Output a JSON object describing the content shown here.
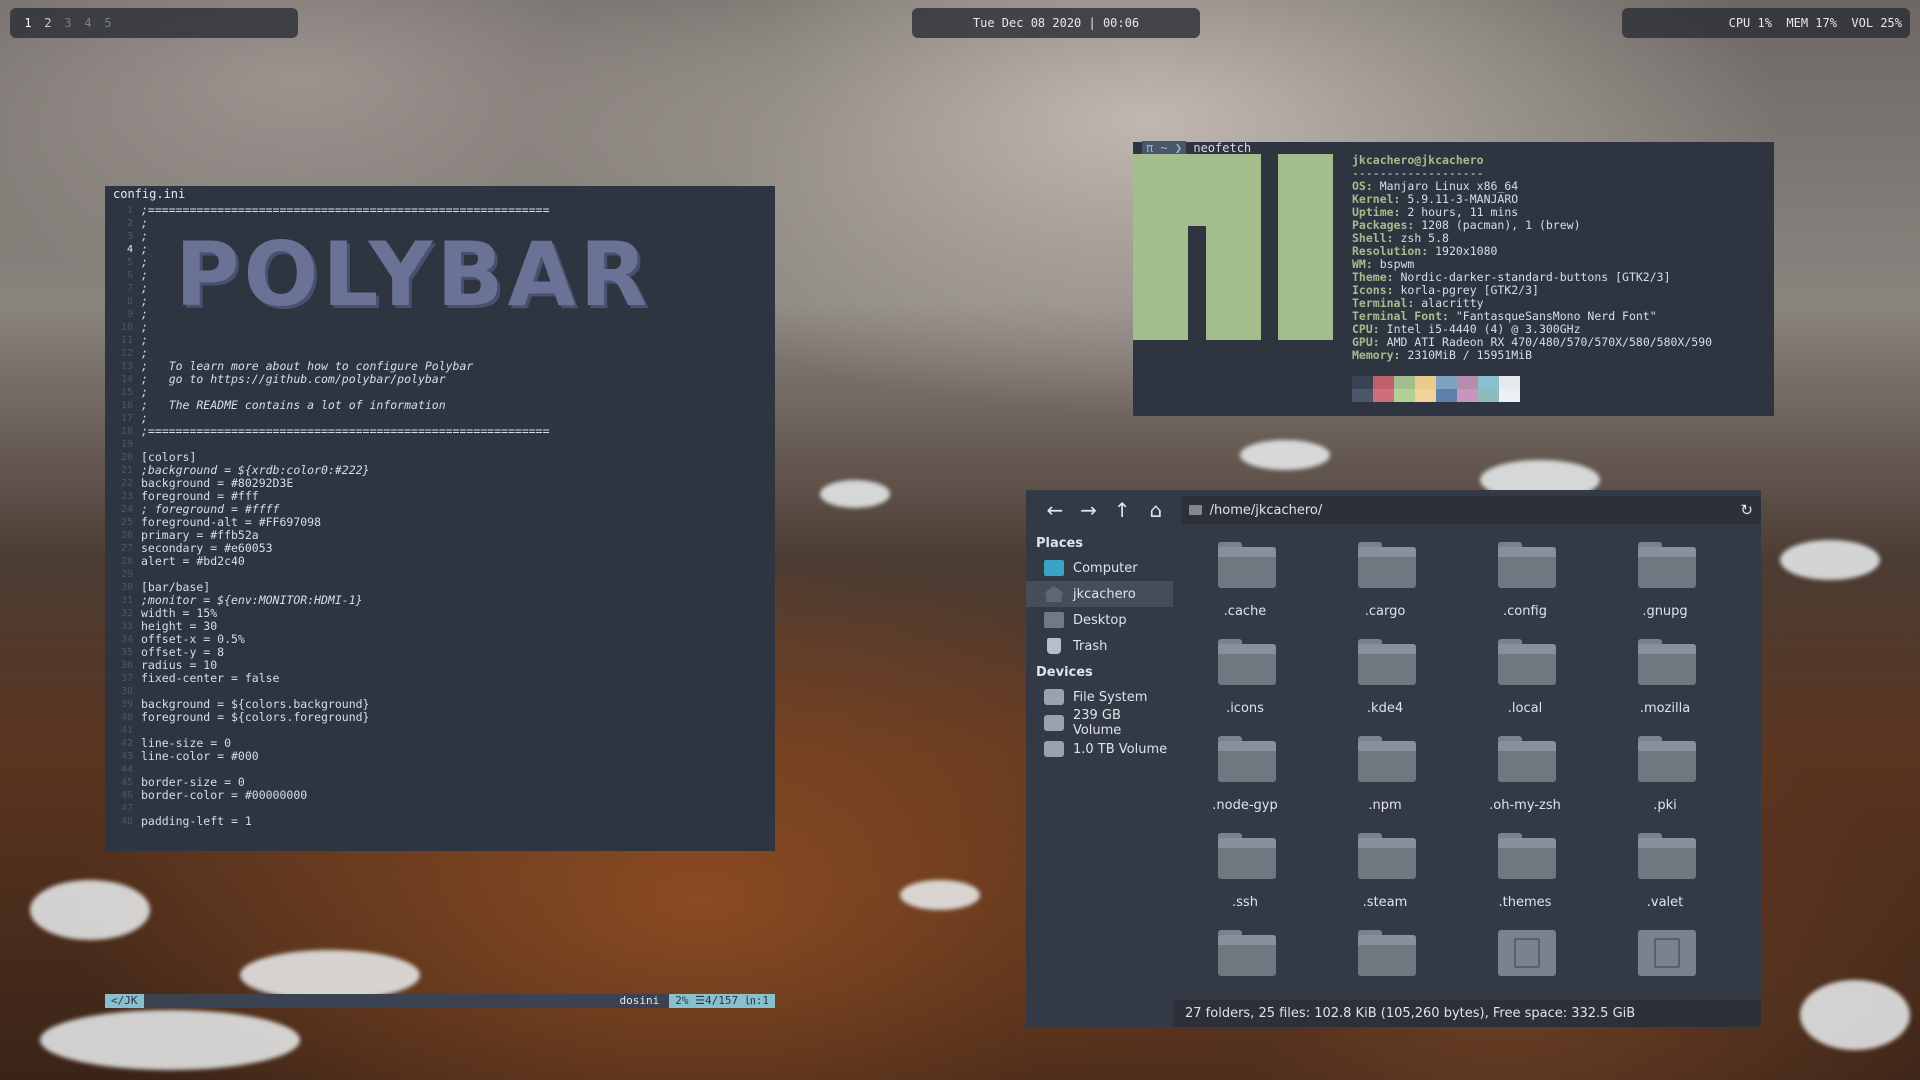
{
  "topbar": {
    "workspaces": [
      "1",
      "2",
      "3",
      "4",
      "5"
    ],
    "active_workspace": "1",
    "clock": "Tue Dec 08 2020 | 00:06",
    "stats": "CPU 1%  MEM 17%  VOL 25%"
  },
  "editor": {
    "title": "config.ini",
    "logo_text": "POLYBAR",
    "mode": "</JK",
    "filetype": "dosini",
    "position": "2% ☰4/157 ㏑:1",
    "lines": [
      {
        "n": "1",
        "t": ";=========================================================="
      },
      {
        "n": "2",
        "t": ";"
      },
      {
        "n": "3",
        "t": ";"
      },
      {
        "n": "4",
        "t": ";"
      },
      {
        "n": "5",
        "t": ";"
      },
      {
        "n": "6",
        "t": ";"
      },
      {
        "n": "7",
        "t": ";"
      },
      {
        "n": "8",
        "t": ";"
      },
      {
        "n": "9",
        "t": ";"
      },
      {
        "n": "10",
        "t": ";"
      },
      {
        "n": "11",
        "t": ";"
      },
      {
        "n": "12",
        "t": ";"
      },
      {
        "n": "13",
        "t": ";   To learn more about how to configure Polybar"
      },
      {
        "n": "14",
        "t": ";   go to https://github.com/polybar/polybar"
      },
      {
        "n": "15",
        "t": ";"
      },
      {
        "n": "16",
        "t": ";   The README contains a lot of information"
      },
      {
        "n": "17",
        "t": ";"
      },
      {
        "n": "18",
        "t": ";=========================================================="
      },
      {
        "n": "19",
        "t": ""
      },
      {
        "n": "20",
        "t": "[colors]"
      },
      {
        "n": "21",
        "t": ";background = ${xrdb:color0:#222}"
      },
      {
        "n": "22",
        "t": "background = #80292D3E"
      },
      {
        "n": "23",
        "t": "foreground = #fff"
      },
      {
        "n": "24",
        "t": "; foreground = #ffff"
      },
      {
        "n": "25",
        "t": "foreground-alt = #FF697098"
      },
      {
        "n": "26",
        "t": "primary = #ffb52a"
      },
      {
        "n": "27",
        "t": "secondary = #e60053"
      },
      {
        "n": "28",
        "t": "alert = #bd2c40"
      },
      {
        "n": "29",
        "t": ""
      },
      {
        "n": "30",
        "t": "[bar/base]"
      },
      {
        "n": "31",
        "t": ";monitor = ${env:MONITOR:HDMI-1}"
      },
      {
        "n": "32",
        "t": "width = 15%"
      },
      {
        "n": "33",
        "t": "height = 30"
      },
      {
        "n": "34",
        "t": "offset-x = 0.5%"
      },
      {
        "n": "35",
        "t": "offset-y = 8"
      },
      {
        "n": "36",
        "t": "radius = 10"
      },
      {
        "n": "37",
        "t": "fixed-center = false"
      },
      {
        "n": "38",
        "t": ""
      },
      {
        "n": "39",
        "t": "background = ${colors.background}"
      },
      {
        "n": "40",
        "t": "foreground = ${colors.foreground}"
      },
      {
        "n": "41",
        "t": ""
      },
      {
        "n": "42",
        "t": "line-size = 0"
      },
      {
        "n": "43",
        "t": "line-color = #000"
      },
      {
        "n": "44",
        "t": ""
      },
      {
        "n": "45",
        "t": "border-size = 0"
      },
      {
        "n": "46",
        "t": "border-color = #00000000"
      },
      {
        "n": "47",
        "t": ""
      },
      {
        "n": "48",
        "t": "padding-left = 1"
      }
    ]
  },
  "neofetch": {
    "prompt_symbol": "π ~ ❯",
    "command": "neofetch",
    "user_host": "jkcachero@jkcachero",
    "separator": "-------------------",
    "info": [
      {
        "k": "OS",
        "v": "Manjaro Linux x86_64"
      },
      {
        "k": "Kernel",
        "v": "5.9.11-3-MANJARO"
      },
      {
        "k": "Uptime",
        "v": "2 hours, 11 mins"
      },
      {
        "k": "Packages",
        "v": "1208 (pacman), 1 (brew)"
      },
      {
        "k": "Shell",
        "v": "zsh 5.8"
      },
      {
        "k": "Resolution",
        "v": "1920x1080"
      },
      {
        "k": "WM",
        "v": "bspwm"
      },
      {
        "k": "Theme",
        "v": "Nordic-darker-standard-buttons [GTK2/3]"
      },
      {
        "k": "Icons",
        "v": "korla-pgrey [GTK2/3]"
      },
      {
        "k": "Terminal",
        "v": "alacritty"
      },
      {
        "k": "Terminal Font",
        "v": "\"FantasqueSansMono Nerd Font\""
      },
      {
        "k": "CPU",
        "v": "Intel i5-4440 (4) @ 3.300GHz"
      },
      {
        "k": "GPU",
        "v": "AMD ATI Radeon RX 470/480/570/570X/580/580X/590"
      },
      {
        "k": "Memory",
        "v": "2310MiB / 15951MiB"
      }
    ],
    "palette_top": [
      "#3b4252",
      "#bf616a",
      "#a3be8c",
      "#ebcb8b",
      "#81a1c1",
      "#b48ead",
      "#88c0d0",
      "#e5e9f0"
    ],
    "palette_bottom": [
      "#4c566a",
      "#d06f79",
      "#b1d196",
      "#f0d399",
      "#5e81ac",
      "#c895bf",
      "#8fbcbb",
      "#eceff4"
    ]
  },
  "filemanager": {
    "path": "/home/jkcachero/",
    "places_label": "Places",
    "devices_label": "Devices",
    "places": [
      "Computer",
      "jkcachero",
      "Desktop",
      "Trash"
    ],
    "devices": [
      "File System",
      "239 GB Volume",
      "1.0 TB Volume"
    ],
    "items": [
      ".cache",
      ".cargo",
      ".config",
      ".gnupg",
      ".icons",
      ".kde4",
      ".local",
      ".mozilla",
      ".node-gyp",
      ".npm",
      ".oh-my-zsh",
      ".pki",
      ".ssh",
      ".steam",
      ".themes",
      ".valet"
    ],
    "status": "27 folders, 25 files: 102.8 KiB (105,260 bytes), Free space: 332.5 GiB"
  }
}
